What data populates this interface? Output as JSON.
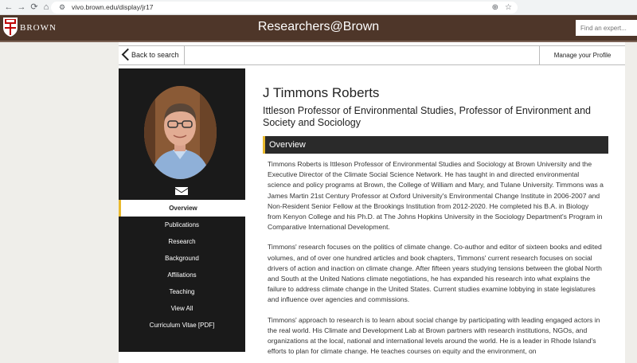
{
  "browser": {
    "url": "vivo.brown.edu/display/jr17"
  },
  "header": {
    "logo_text": "BROWN",
    "site_title": "Researchers@Brown",
    "search_placeholder": "Find an expert..."
  },
  "topbar": {
    "back_label": "Back to search",
    "manage_label": "Manage your Profile"
  },
  "sidebar": {
    "items": [
      {
        "label": "Overview",
        "active": true
      },
      {
        "label": "Publications"
      },
      {
        "label": "Research"
      },
      {
        "label": "Background"
      },
      {
        "label": "Affiliations"
      },
      {
        "label": "Teaching"
      },
      {
        "label": "View All"
      },
      {
        "label": "Curriculum Vitae [PDF]"
      }
    ]
  },
  "profile": {
    "name": "J Timmons Roberts",
    "title": "Ittleson Professor of Environmental Studies, Professor of Environment and Society and Sociology",
    "section": "Overview",
    "paragraphs": [
      "Timmons Roberts is Ittleson Professor of Environmental Studies and Sociology at Brown University and the Executive Director of the Climate Social Science Network. He has taught in and directed environmental science and policy programs at Brown, the College of William and Mary, and Tulane University. Timmons was a James Martin 21st Century Professor at Oxford University's Environmental Change Institute in 2006-2007 and Non-Resident Senior Fellow at the Brookings Institution from 2012-2020. He completed his B.A. in Biology from Kenyon College and his Ph.D. at The Johns Hopkins University in the Sociology Department's Program in Comparative International Development.",
      "Timmons' research focuses on the politics of climate change. Co-author and editor of sixteen books and edited volumes, and of over one hundred articles and book chapters, Timmons' current research focuses on social drivers of action and inaction on climate change. After fifteen years studying tensions between the global North and South at the United Nations climate negotiations, he has expanded his research into what explains the failure to address climate change in the United States. Current studies examine lobbying in state legislatures and influence over agencies and commissions.",
      "Timmons' approach to research is to learn about social change by participating with leading engaged actors in the real world. His Climate and Development Lab at Brown partners with research institutions, NGOs, and organizations at the local, national and international levels around the world. He is a leader in Rhode Island's efforts to plan for climate change. He teaches courses on equity and the environment, on"
    ]
  },
  "colors": {
    "brand_brown": "#4e3629",
    "accent_gold": "#e9b92d",
    "sidebar_dark": "#1a1a1a"
  }
}
